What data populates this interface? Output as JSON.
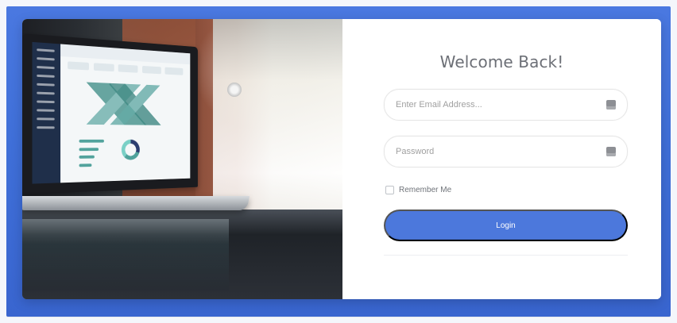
{
  "page": {
    "title": "Welcome Back!"
  },
  "form": {
    "email_placeholder": "Enter Email Address...",
    "password_placeholder": "Password",
    "remember_label": "Remember Me",
    "login_label": "Login"
  },
  "icons": {
    "email": "credential-icon",
    "password": "credential-icon"
  },
  "colors": {
    "background": "#3f6fd8",
    "button": "#4c78dc",
    "card": "#ffffff"
  }
}
